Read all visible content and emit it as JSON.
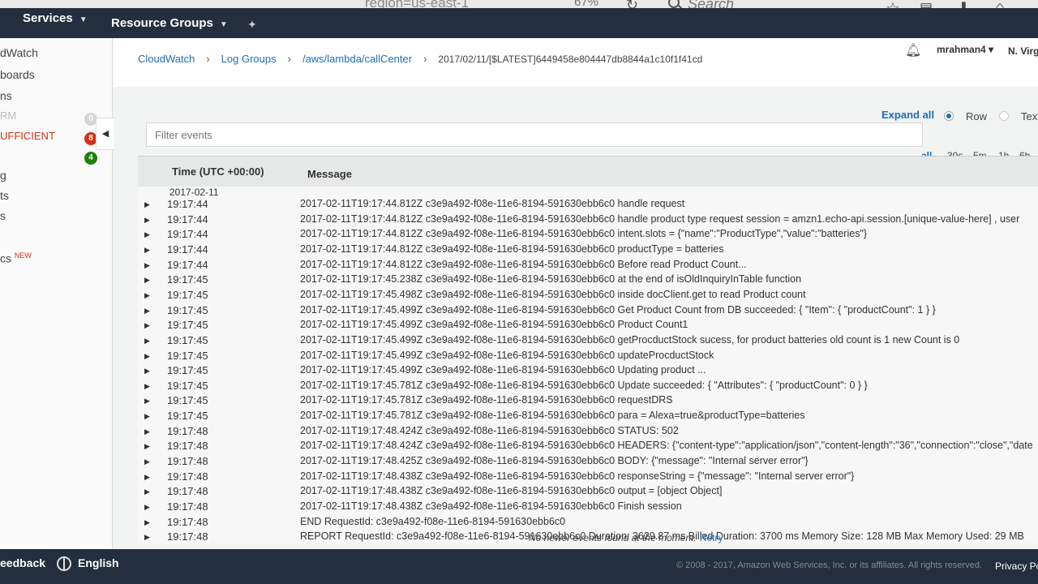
{
  "browser": {
    "url_fragment": "region=us-east-1",
    "zoom": "67%",
    "search_placeholder": "Search"
  },
  "topnav": {
    "services": "Services",
    "resource_groups": "Resource Groups"
  },
  "account": {
    "user": "mrahman4",
    "region": "N. Virg"
  },
  "sidebar": {
    "items": [
      {
        "label": "dWatch"
      },
      {
        "label": "boards"
      },
      {
        "label": "ns"
      },
      {
        "label": "RM"
      },
      {
        "label": "UFFICIENT"
      },
      {
        "label": ""
      },
      {
        "label": "g"
      },
      {
        "label": "ts"
      },
      {
        "label": "s"
      },
      {
        "label": "cs"
      }
    ],
    "badges": [
      "0",
      "8",
      "4"
    ],
    "new_tag": "NEW"
  },
  "breadcrumb": {
    "items": [
      "CloudWatch",
      "Log Groups",
      "/aws/lambda/callCenter"
    ],
    "current": "2017/02/11/[$LATEST]6449458e804447db8844a1c10f1f41cd"
  },
  "view": {
    "expand_all": "Expand all",
    "row_label": "Row",
    "text_label": "Text"
  },
  "filter": {
    "placeholder": "Filter events"
  },
  "time_ranges": [
    "all",
    "30s",
    "5m",
    "1h",
    "6h"
  ],
  "table": {
    "col_time": "Time (UTC +00:00)",
    "col_message": "Message",
    "date": "2017-02-11",
    "rows": [
      {
        "time": "19:17:44",
        "message": "2017-02-11T19:17:44.812Z c3e9a492-f08e-11e6-8194-591630ebb6c0 handle request"
      },
      {
        "time": "19:17:44",
        "message": "2017-02-11T19:17:44.812Z c3e9a492-f08e-11e6-8194-591630ebb6c0 handle product type request session = amzn1.echo-api.session.[unique-value-here] , user"
      },
      {
        "time": "19:17:44",
        "message": "2017-02-11T19:17:44.812Z c3e9a492-f08e-11e6-8194-591630ebb6c0 intent.slots = {\"name\":\"ProductType\",\"value\":\"batteries\"}"
      },
      {
        "time": "19:17:44",
        "message": "2017-02-11T19:17:44.812Z c3e9a492-f08e-11e6-8194-591630ebb6c0 productType = batteries"
      },
      {
        "time": "19:17:44",
        "message": "2017-02-11T19:17:44.812Z c3e9a492-f08e-11e6-8194-591630ebb6c0 Before read Product Count..."
      },
      {
        "time": "19:17:45",
        "message": "2017-02-11T19:17:45.238Z c3e9a492-f08e-11e6-8194-591630ebb6c0 at the end of isOldInquiryInTable function"
      },
      {
        "time": "19:17:45",
        "message": "2017-02-11T19:17:45.498Z c3e9a492-f08e-11e6-8194-591630ebb6c0 inside docClient.get to read Product count"
      },
      {
        "time": "19:17:45",
        "message": "2017-02-11T19:17:45.499Z c3e9a492-f08e-11e6-8194-591630ebb6c0 Get Product Count from DB succeeded: { \"Item\": { \"productCount\": 1 } }"
      },
      {
        "time": "19:17:45",
        "message": "2017-02-11T19:17:45.499Z c3e9a492-f08e-11e6-8194-591630ebb6c0 Product Count1"
      },
      {
        "time": "19:17:45",
        "message": "2017-02-11T19:17:45.499Z c3e9a492-f08e-11e6-8194-591630ebb6c0 getProcductStock sucess, for product batteries old count is 1 new Count is 0"
      },
      {
        "time": "19:17:45",
        "message": "2017-02-11T19:17:45.499Z c3e9a492-f08e-11e6-8194-591630ebb6c0 updateProcductStock"
      },
      {
        "time": "19:17:45",
        "message": "2017-02-11T19:17:45.499Z c3e9a492-f08e-11e6-8194-591630ebb6c0 Updating product ..."
      },
      {
        "time": "19:17:45",
        "message": "2017-02-11T19:17:45.781Z c3e9a492-f08e-11e6-8194-591630ebb6c0 Update succeeded: { \"Attributes\": { \"productCount\": 0 } }"
      },
      {
        "time": "19:17:45",
        "message": "2017-02-11T19:17:45.781Z c3e9a492-f08e-11e6-8194-591630ebb6c0 requestDRS"
      },
      {
        "time": "19:17:45",
        "message": "2017-02-11T19:17:45.781Z c3e9a492-f08e-11e6-8194-591630ebb6c0 para = Alexa=true&productType=batteries"
      },
      {
        "time": "19:17:48",
        "message": "2017-02-11T19:17:48.424Z c3e9a492-f08e-11e6-8194-591630ebb6c0 STATUS: 502"
      },
      {
        "time": "19:17:48",
        "message": "2017-02-11T19:17:48.424Z c3e9a492-f08e-11e6-8194-591630ebb6c0 HEADERS: {\"content-type\":\"application/json\",\"content-length\":\"36\",\"connection\":\"close\",\"date"
      },
      {
        "time": "19:17:48",
        "message": "2017-02-11T19:17:48.425Z c3e9a492-f08e-11e6-8194-591630ebb6c0 BODY: {\"message\": \"Internal server error\"}"
      },
      {
        "time": "19:17:48",
        "message": "2017-02-11T19:17:48.438Z c3e9a492-f08e-11e6-8194-591630ebb6c0 responseString = {\"message\": \"Internal server error\"}"
      },
      {
        "time": "19:17:48",
        "message": "2017-02-11T19:17:48.438Z c3e9a492-f08e-11e6-8194-591630ebb6c0 output = [object Object]"
      },
      {
        "time": "19:17:48",
        "message": "2017-02-11T19:17:48.438Z c3e9a492-f08e-11e6-8194-591630ebb6c0 Finish session"
      },
      {
        "time": "19:17:48",
        "message": "END RequestId: c3e9a492-f08e-11e6-8194-591630ebb6c0"
      },
      {
        "time": "19:17:48",
        "message": "REPORT RequestId: c3e9a492-f08e-11e6-8194-591630ebb6c0 Duration: 3629.87 ms Billed Duration: 3700 ms Memory Size: 128 MB Max Memory Used: 29 MB"
      }
    ]
  },
  "status": {
    "no_newer": "No newer events found at the moment.",
    "retry": "Retry"
  },
  "footer": {
    "feedback": "eedback",
    "language": "English",
    "copyright": "© 2008 - 2017, Amazon Web Services, Inc. or its affiliates. All rights reserved.",
    "privacy": "Privacy Po"
  },
  "colors": {
    "nav_bg": "#232f3e",
    "link": "#1d6fb5",
    "badge_red": "#d13212",
    "badge_green": "#1d8102",
    "badge_gray": "#d5d5d5"
  }
}
